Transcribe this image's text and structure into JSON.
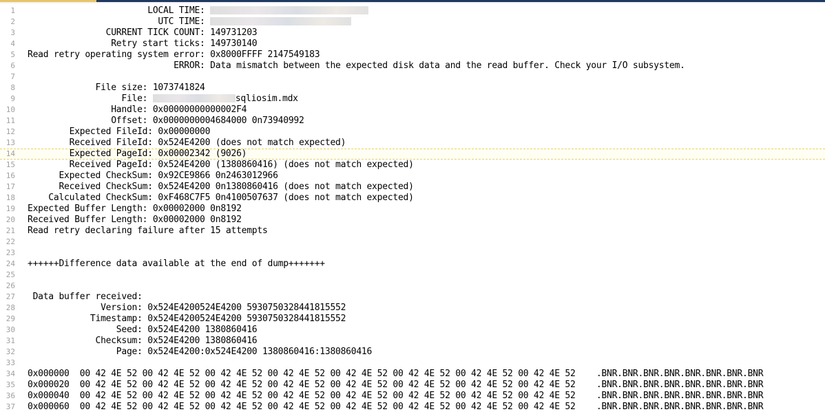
{
  "lines": [
    {
      "n": "1",
      "pre": "                       LOCAL TIME: ",
      "redact": 230,
      "post": ""
    },
    {
      "n": "2",
      "pre": "                         UTC TIME: ",
      "redact": 205,
      "post": ""
    },
    {
      "n": "3",
      "pre": "               CURRENT TICK COUNT: 149731203",
      "redact": 0,
      "post": ""
    },
    {
      "n": "4",
      "pre": "                Retry start ticks: 149730140",
      "redact": 0,
      "post": ""
    },
    {
      "n": "5",
      "pre": "Read retry operating system error: 0x8000FFFF 2147549183",
      "redact": 0,
      "post": ""
    },
    {
      "n": "6",
      "pre": "                            ERROR: Data mismatch between the expected disk data and the read buffer. Check your I/O subsystem.",
      "redact": 0,
      "post": ""
    },
    {
      "n": "7",
      "pre": "",
      "redact": 0,
      "post": ""
    },
    {
      "n": "8",
      "pre": "             File size: 1073741824",
      "redact": 0,
      "post": ""
    },
    {
      "n": "9",
      "pre": "                  File: ",
      "redact": 120,
      "post": "sqliosim.mdx"
    },
    {
      "n": "10",
      "pre": "                Handle: 0x00000000000002F4",
      "redact": 0,
      "post": ""
    },
    {
      "n": "11",
      "pre": "                Offset: 0x0000000004684000 0n73940992",
      "redact": 0,
      "post": ""
    },
    {
      "n": "12",
      "pre": "        Expected FileId: 0x00000000",
      "redact": 0,
      "post": ""
    },
    {
      "n": "13",
      "pre": "        Received FileId: 0x524E4200 (does not match expected)",
      "redact": 0,
      "post": ""
    },
    {
      "n": "14",
      "pre": "        Expected PageId: 0x00002342 (9026)",
      "redact": 0,
      "post": "",
      "hl": true
    },
    {
      "n": "15",
      "pre": "        Received PageId: 0x524E4200 (1380860416) (does not match expected)",
      "redact": 0,
      "post": ""
    },
    {
      "n": "16",
      "pre": "      Expected CheckSum: 0x92CE9866 0n2463012966",
      "redact": 0,
      "post": ""
    },
    {
      "n": "17",
      "pre": "      Received CheckSum: 0x524E4200 0n1380860416 (does not match expected)",
      "redact": 0,
      "post": ""
    },
    {
      "n": "18",
      "pre": "    Calculated CheckSum: 0xF468C7F5 0n4100507637 (does not match expected)",
      "redact": 0,
      "post": ""
    },
    {
      "n": "19",
      "pre": "Expected Buffer Length: 0x00002000 0n8192",
      "redact": 0,
      "post": ""
    },
    {
      "n": "20",
      "pre": "Received Buffer Length: 0x00002000 0n8192",
      "redact": 0,
      "post": ""
    },
    {
      "n": "21",
      "pre": "Read retry declaring failure after 15 attempts",
      "redact": 0,
      "post": ""
    },
    {
      "n": "22",
      "pre": "",
      "redact": 0,
      "post": ""
    },
    {
      "n": "23",
      "pre": "",
      "redact": 0,
      "post": ""
    },
    {
      "n": "24",
      "pre": "++++++Difference data available at the end of dump+++++++",
      "redact": 0,
      "post": ""
    },
    {
      "n": "25",
      "pre": "",
      "redact": 0,
      "post": ""
    },
    {
      "n": "26",
      "pre": "",
      "redact": 0,
      "post": ""
    },
    {
      "n": "27",
      "pre": " Data buffer received:",
      "redact": 0,
      "post": ""
    },
    {
      "n": "28",
      "pre": "              Version: 0x524E4200524E4200 5930750328441815552",
      "redact": 0,
      "post": ""
    },
    {
      "n": "29",
      "pre": "            Timestamp: 0x524E4200524E4200 5930750328441815552",
      "redact": 0,
      "post": ""
    },
    {
      "n": "30",
      "pre": "                 Seed: 0x524E4200 1380860416",
      "redact": 0,
      "post": ""
    },
    {
      "n": "31",
      "pre": "             Checksum: 0x524E4200 1380860416",
      "redact": 0,
      "post": ""
    },
    {
      "n": "32",
      "pre": "                 Page: 0x524E4200:0x524E4200 1380860416:1380860416",
      "redact": 0,
      "post": ""
    },
    {
      "n": "33",
      "pre": "",
      "redact": 0,
      "post": ""
    },
    {
      "n": "34",
      "pre": "0x000000  00 42 4E 52 00 42 4E 52 00 42 4E 52 00 42 4E 52 00 42 4E 52 00 42 4E 52 00 42 4E 52 00 42 4E 52    .BNR.BNR.BNR.BNR.BNR.BNR.BNR.BNR",
      "redact": 0,
      "post": ""
    },
    {
      "n": "35",
      "pre": "0x000020  00 42 4E 52 00 42 4E 52 00 42 4E 52 00 42 4E 52 00 42 4E 52 00 42 4E 52 00 42 4E 52 00 42 4E 52    .BNR.BNR.BNR.BNR.BNR.BNR.BNR.BNR",
      "redact": 0,
      "post": ""
    },
    {
      "n": "36",
      "pre": "0x000040  00 42 4E 52 00 42 4E 52 00 42 4E 52 00 42 4E 52 00 42 4E 52 00 42 4E 52 00 42 4E 52 00 42 4E 52    .BNR.BNR.BNR.BNR.BNR.BNR.BNR.BNR",
      "redact": 0,
      "post": ""
    },
    {
      "n": "37",
      "pre": "0x000060  00 42 4E 52 00 42 4E 52 00 42 4E 52 00 42 4E 52 00 42 4E 52 00 42 4E 52 00 42 4E 52 00 42 4E 52    .BNR.BNR.BNR.BNR.BNR.BNR.BNR.BNR",
      "redact": 0,
      "post": ""
    }
  ]
}
